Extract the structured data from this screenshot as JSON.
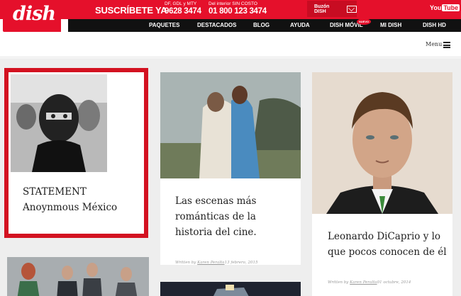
{
  "header": {
    "logo": "dish",
    "subscribe": "SUSCRÍBETE YA",
    "phone_local_label": "DF, GDL y MTY",
    "phone_local": "9628 3474",
    "phone_interior_label": "Del interior SIN COSTO",
    "phone_interior": "01 800 123 3474",
    "mailbox": "Buzón DISH",
    "youtube_you": "You",
    "youtube_tube": "Tube",
    "colors": {
      "brand_red": "#e5102b",
      "nav_black": "#111111",
      "highlight_border": "#d31221"
    }
  },
  "nav": {
    "items": [
      "PAQUETES",
      "DESTACADOS",
      "BLOG",
      "AYUDA",
      "DISH MÓVIL",
      "MI DISH",
      "DISH HD"
    ],
    "badge": "NUEVO"
  },
  "menu": {
    "label": "Menu",
    "icon": "hamburger-icon"
  },
  "cards": [
    {
      "title_line1": "STATEMENT",
      "title_line2": "Anoynmous México"
    },
    {
      "title_line1": "Las escenas más",
      "title_line2": "románticas de la",
      "title_line3": "historia del cine.",
      "meta_prefix": "Written by",
      "author": "Karen Peralta",
      "date": "13 febrero, 2015"
    },
    {
      "title_line1": "Leonardo DiCaprio y lo",
      "title_line2": "que pocos conocen de él",
      "meta_prefix": "Written by",
      "author": "Karen Peralta",
      "date": "01 octubre, 2014"
    }
  ]
}
